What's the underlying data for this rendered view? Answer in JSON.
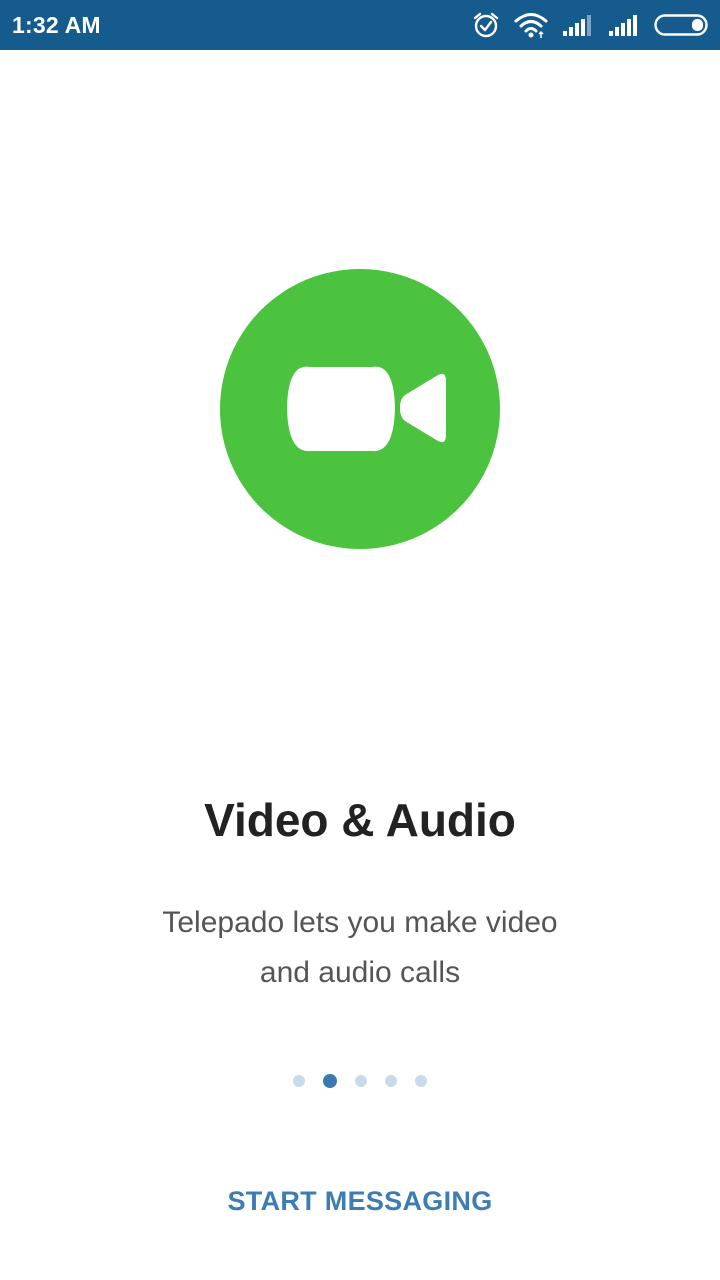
{
  "status_bar": {
    "time": "1:32 AM",
    "background_color": "#165b8e",
    "icons": [
      "alarm-icon",
      "wifi-icon",
      "signal-icon",
      "signal-icon",
      "battery-icon"
    ]
  },
  "hero": {
    "icon": "video-camera-icon",
    "circle_color": "#4bc33e"
  },
  "intro": {
    "title": "Video & Audio",
    "description_line1": "Telepado lets you make video",
    "description_line2": "and audio calls"
  },
  "pager": {
    "total_pages": 5,
    "active_index": 1,
    "active_color": "#3a78ad",
    "inactive_color": "#c9dbe8"
  },
  "actions": {
    "start_label": "START MESSAGING",
    "color": "#3c7db4"
  }
}
